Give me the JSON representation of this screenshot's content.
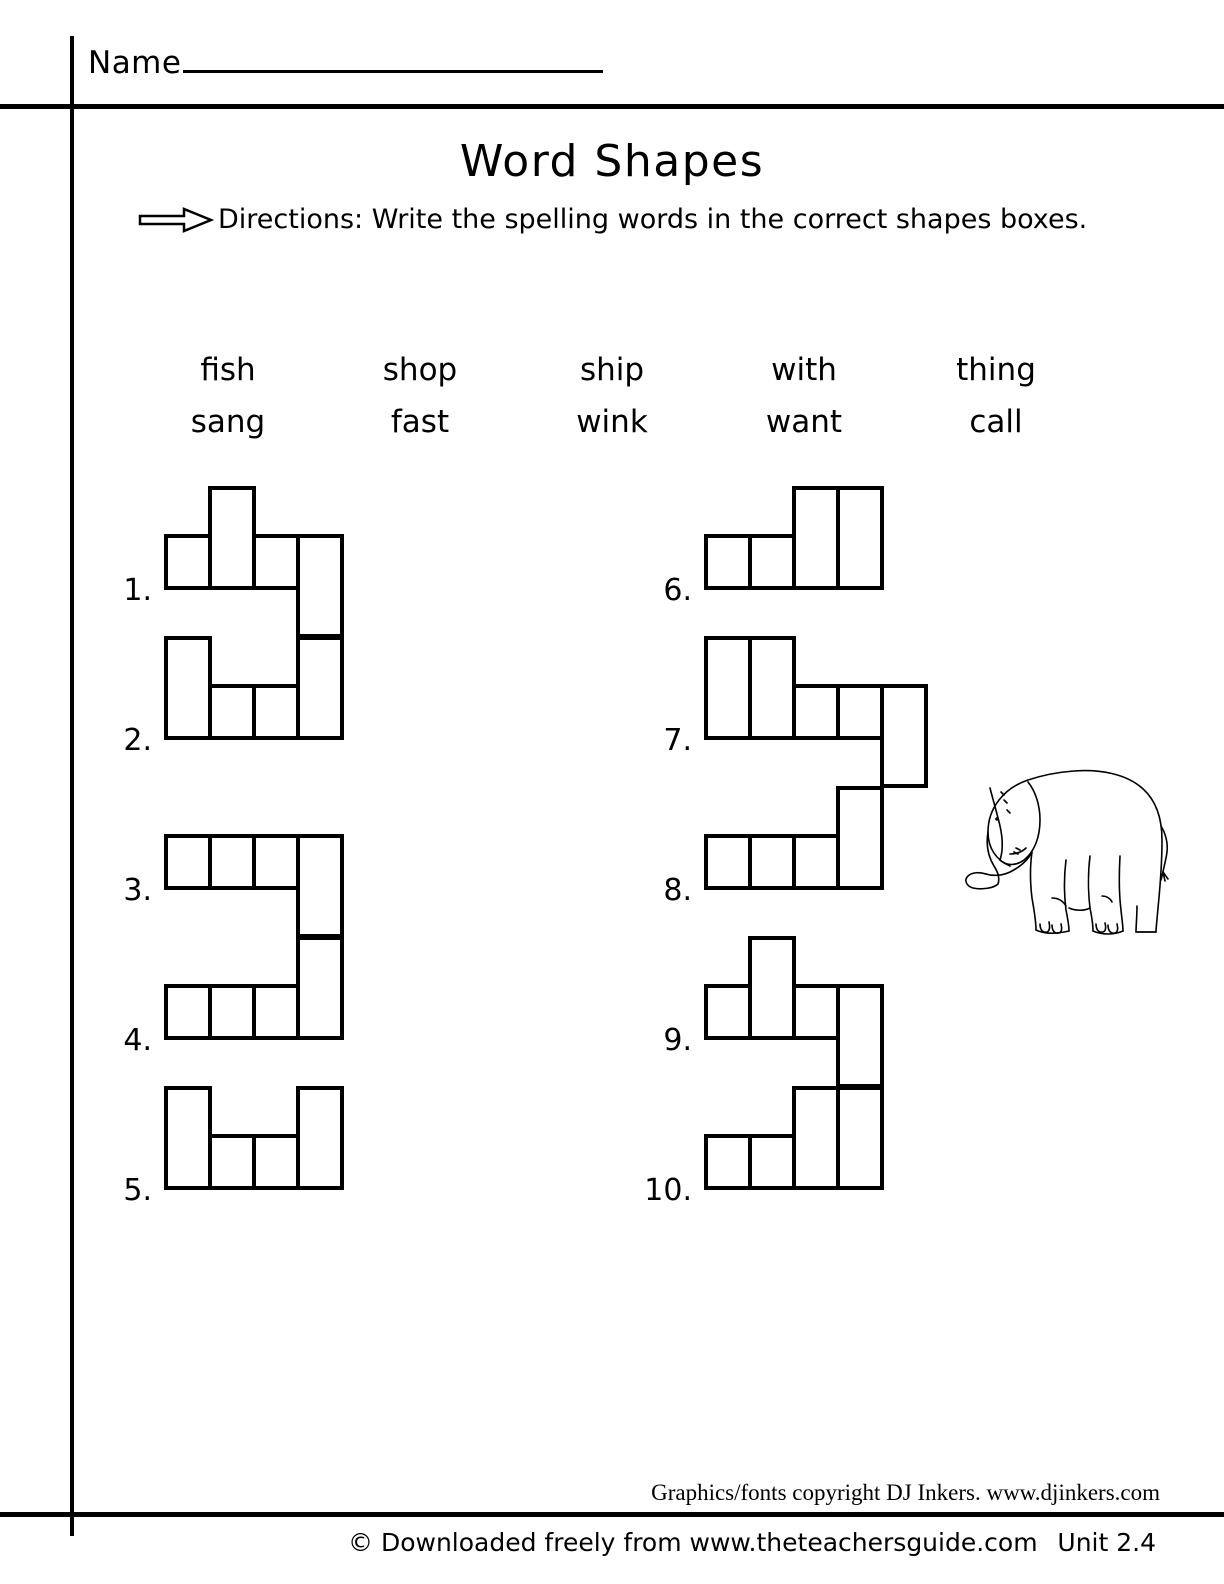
{
  "header": {
    "name_label": "Name",
    "name_value": ""
  },
  "title": "Word Shapes",
  "directions": {
    "icon": "right-arrow-icon",
    "text": "Directions: Write the spelling words in the correct shapes boxes."
  },
  "word_bank": {
    "rows": [
      [
        "fish",
        "shop",
        "ship",
        "with",
        "thing"
      ],
      [
        "sang",
        "fast",
        "wink",
        "want",
        "call"
      ]
    ]
  },
  "shapes": {
    "left_column": [
      {
        "number": "1.",
        "boxes": [
          "short",
          "tall",
          "short",
          "desc"
        ]
      },
      {
        "number": "2.",
        "boxes": [
          "tall",
          "short",
          "short",
          "tall"
        ]
      },
      {
        "number": "3.",
        "boxes": [
          "short",
          "short",
          "short",
          "desc"
        ]
      },
      {
        "number": "4.",
        "boxes": [
          "short",
          "short",
          "short",
          "tall"
        ]
      },
      {
        "number": "5.",
        "boxes": [
          "tall",
          "short",
          "short",
          "tall"
        ]
      }
    ],
    "right_column": [
      {
        "number": "6.",
        "boxes": [
          "short",
          "short",
          "tall",
          "tall"
        ]
      },
      {
        "number": "7.",
        "boxes": [
          "tall",
          "tall",
          "short",
          "short",
          "desc"
        ]
      },
      {
        "number": "8.",
        "boxes": [
          "short",
          "short",
          "short",
          "tall"
        ]
      },
      {
        "number": "9.",
        "boxes": [
          "short",
          "tall",
          "short",
          "desc"
        ]
      },
      {
        "number": "10.",
        "boxes": [
          "short",
          "short",
          "tall",
          "tall"
        ]
      }
    ]
  },
  "graphic": {
    "name": "elephant-illustration"
  },
  "credit": "Graphics/fonts copyright DJ Inkers. www.djinkers.com",
  "footer": {
    "left": "© Downloaded freely from www.theteachersguide.com",
    "right": "Unit 2.4"
  },
  "colors": {
    "ink": "#000000",
    "paper": "#ffffff"
  }
}
